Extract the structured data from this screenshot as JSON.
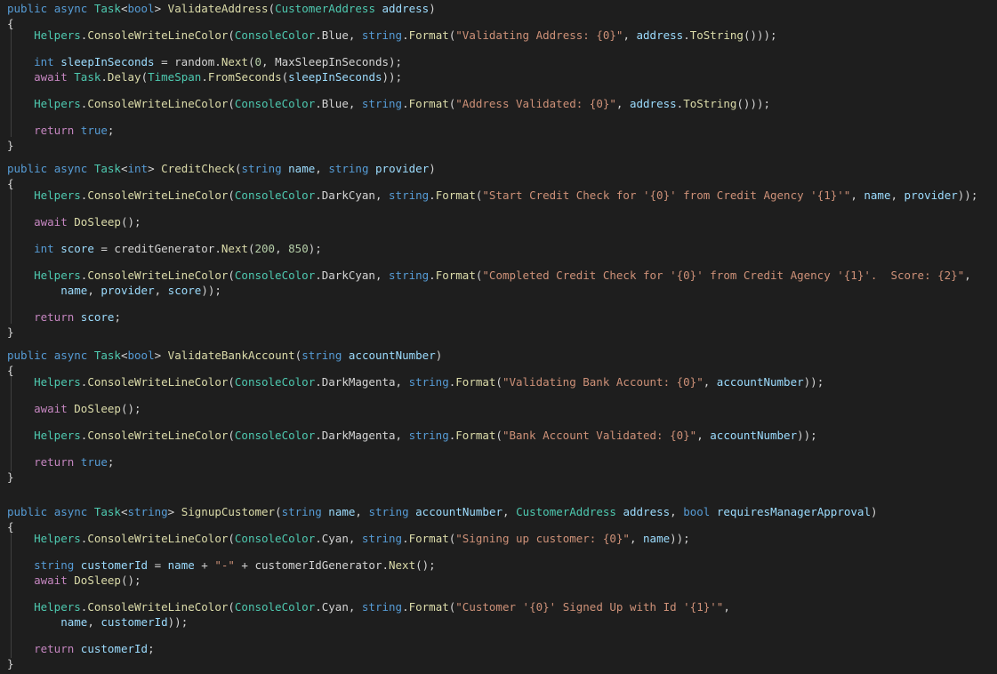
{
  "editor": {
    "language": "csharp",
    "token_colors": {
      "kw": "#569cd6",
      "ctl": "#c586c0",
      "type": "#4ec9b0",
      "fn": "#dcdcaa",
      "var": "#9cdcfe",
      "str": "#ce9178",
      "num": "#b5cea8",
      "punc": "#d4d4d4",
      "background": "#1e1e1e"
    },
    "lines": [
      [
        [
          "kw",
          "public"
        ],
        [
          "punc",
          " "
        ],
        [
          "kw",
          "async"
        ],
        [
          "punc",
          " "
        ],
        [
          "type",
          "Task"
        ],
        [
          "punc",
          "<"
        ],
        [
          "kw",
          "bool"
        ],
        [
          "punc",
          "> "
        ],
        [
          "fn",
          "ValidateAddress"
        ],
        [
          "punc",
          "("
        ],
        [
          "type",
          "CustomerAddress"
        ],
        [
          "punc",
          " "
        ],
        [
          "var",
          "address"
        ],
        [
          "punc",
          ")"
        ]
      ],
      [
        [
          "brace",
          "{"
        ]
      ],
      [
        [
          "punc",
          "    "
        ],
        [
          "type",
          "Helpers"
        ],
        [
          "punc",
          "."
        ],
        [
          "fn",
          "ConsoleWriteLineColor"
        ],
        [
          "punc",
          "("
        ],
        [
          "type",
          "ConsoleColor"
        ],
        [
          "punc",
          ".Blue, "
        ],
        [
          "kw",
          "string"
        ],
        [
          "punc",
          "."
        ],
        [
          "fn",
          "Format"
        ],
        [
          "punc",
          "("
        ],
        [
          "str",
          "\"Validating Address: {0}\""
        ],
        [
          "punc",
          ", "
        ],
        [
          "var",
          "address"
        ],
        [
          "punc",
          "."
        ],
        [
          "fn",
          "ToString"
        ],
        [
          "punc",
          "()));"
        ]
      ],
      [
        [
          "punc",
          "    "
        ],
        [
          "kw",
          "int"
        ],
        [
          "punc",
          " "
        ],
        [
          "var",
          "sleepInSeconds"
        ],
        [
          "punc",
          " = random."
        ],
        [
          "fn",
          "Next"
        ],
        [
          "punc",
          "("
        ],
        [
          "num",
          "0"
        ],
        [
          "punc",
          ", MaxSleepInSeconds);"
        ]
      ],
      [
        [
          "punc",
          "    "
        ],
        [
          "ctl",
          "await"
        ],
        [
          "punc",
          " "
        ],
        [
          "type",
          "Task"
        ],
        [
          "punc",
          "."
        ],
        [
          "fn",
          "Delay"
        ],
        [
          "punc",
          "("
        ],
        [
          "type",
          "TimeSpan"
        ],
        [
          "punc",
          "."
        ],
        [
          "fn",
          "FromSeconds"
        ],
        [
          "punc",
          "("
        ],
        [
          "var",
          "sleepInSeconds"
        ],
        [
          "punc",
          "));"
        ]
      ],
      [
        [
          "punc",
          "    "
        ],
        [
          "type",
          "Helpers"
        ],
        [
          "punc",
          "."
        ],
        [
          "fn",
          "ConsoleWriteLineColor"
        ],
        [
          "punc",
          "("
        ],
        [
          "type",
          "ConsoleColor"
        ],
        [
          "punc",
          ".Blue, "
        ],
        [
          "kw",
          "string"
        ],
        [
          "punc",
          "."
        ],
        [
          "fn",
          "Format"
        ],
        [
          "punc",
          "("
        ],
        [
          "str",
          "\"Address Validated: {0}\""
        ],
        [
          "punc",
          ", "
        ],
        [
          "var",
          "address"
        ],
        [
          "punc",
          "."
        ],
        [
          "fn",
          "ToString"
        ],
        [
          "punc",
          "()));"
        ]
      ],
      [
        [
          "punc",
          "    "
        ],
        [
          "ctl",
          "return"
        ],
        [
          "punc",
          " "
        ],
        [
          "kw",
          "true"
        ],
        [
          "punc",
          ";"
        ]
      ],
      [
        [
          "brace",
          "}"
        ]
      ],
      [
        [
          "kw",
          "public"
        ],
        [
          "punc",
          " "
        ],
        [
          "kw",
          "async"
        ],
        [
          "punc",
          " "
        ],
        [
          "type",
          "Task"
        ],
        [
          "punc",
          "<"
        ],
        [
          "kw",
          "int"
        ],
        [
          "punc",
          "> "
        ],
        [
          "fn",
          "CreditCheck"
        ],
        [
          "punc",
          "("
        ],
        [
          "kw",
          "string"
        ],
        [
          "punc",
          " "
        ],
        [
          "var",
          "name"
        ],
        [
          "punc",
          ", "
        ],
        [
          "kw",
          "string"
        ],
        [
          "punc",
          " "
        ],
        [
          "var",
          "provider"
        ],
        [
          "punc",
          ")"
        ]
      ],
      [
        [
          "brace",
          "{"
        ]
      ],
      [
        [
          "punc",
          "    "
        ],
        [
          "type",
          "Helpers"
        ],
        [
          "punc",
          "."
        ],
        [
          "fn",
          "ConsoleWriteLineColor"
        ],
        [
          "punc",
          "("
        ],
        [
          "type",
          "ConsoleColor"
        ],
        [
          "punc",
          ".DarkCyan, "
        ],
        [
          "kw",
          "string"
        ],
        [
          "punc",
          "."
        ],
        [
          "fn",
          "Format"
        ],
        [
          "punc",
          "("
        ],
        [
          "str",
          "\"Start Credit Check for '{0}' from Credit Agency '{1}'\""
        ],
        [
          "punc",
          ", "
        ],
        [
          "var",
          "name"
        ],
        [
          "punc",
          ", "
        ],
        [
          "var",
          "provider"
        ],
        [
          "punc",
          "));"
        ]
      ],
      [
        [
          "punc",
          "    "
        ],
        [
          "ctl",
          "await"
        ],
        [
          "punc",
          " "
        ],
        [
          "fn",
          "DoSleep"
        ],
        [
          "punc",
          "();"
        ]
      ],
      [
        [
          "punc",
          "    "
        ],
        [
          "kw",
          "int"
        ],
        [
          "punc",
          " "
        ],
        [
          "var",
          "score"
        ],
        [
          "punc",
          " = creditGenerator."
        ],
        [
          "fn",
          "Next"
        ],
        [
          "punc",
          "("
        ],
        [
          "num",
          "200"
        ],
        [
          "punc",
          ", "
        ],
        [
          "num",
          "850"
        ],
        [
          "punc",
          ");"
        ]
      ],
      [
        [
          "punc",
          "    "
        ],
        [
          "type",
          "Helpers"
        ],
        [
          "punc",
          "."
        ],
        [
          "fn",
          "ConsoleWriteLineColor"
        ],
        [
          "punc",
          "("
        ],
        [
          "type",
          "ConsoleColor"
        ],
        [
          "punc",
          ".DarkCyan, "
        ],
        [
          "kw",
          "string"
        ],
        [
          "punc",
          "."
        ],
        [
          "fn",
          "Format"
        ],
        [
          "punc",
          "("
        ],
        [
          "str",
          "\"Completed Credit Check for '{0}' from Credit Agency '{1}'.  Score: {2}\""
        ],
        [
          "punc",
          ","
        ]
      ],
      [
        [
          "punc",
          "        "
        ],
        [
          "var",
          "name"
        ],
        [
          "punc",
          ", "
        ],
        [
          "var",
          "provider"
        ],
        [
          "punc",
          ", "
        ],
        [
          "var",
          "score"
        ],
        [
          "punc",
          "));"
        ]
      ],
      [
        [
          "punc",
          "    "
        ],
        [
          "ctl",
          "return"
        ],
        [
          "punc",
          " "
        ],
        [
          "var",
          "score"
        ],
        [
          "punc",
          ";"
        ]
      ],
      [
        [
          "brace",
          "}"
        ]
      ],
      [
        [
          "kw",
          "public"
        ],
        [
          "punc",
          " "
        ],
        [
          "kw",
          "async"
        ],
        [
          "punc",
          " "
        ],
        [
          "type",
          "Task"
        ],
        [
          "punc",
          "<"
        ],
        [
          "kw",
          "bool"
        ],
        [
          "punc",
          "> "
        ],
        [
          "fn",
          "ValidateBankAccount"
        ],
        [
          "punc",
          "("
        ],
        [
          "kw",
          "string"
        ],
        [
          "punc",
          " "
        ],
        [
          "var",
          "accountNumber"
        ],
        [
          "punc",
          ")"
        ]
      ],
      [
        [
          "brace",
          "{"
        ]
      ],
      [
        [
          "punc",
          "    "
        ],
        [
          "type",
          "Helpers"
        ],
        [
          "punc",
          "."
        ],
        [
          "fn",
          "ConsoleWriteLineColor"
        ],
        [
          "punc",
          "("
        ],
        [
          "type",
          "ConsoleColor"
        ],
        [
          "punc",
          ".DarkMagenta, "
        ],
        [
          "kw",
          "string"
        ],
        [
          "punc",
          "."
        ],
        [
          "fn",
          "Format"
        ],
        [
          "punc",
          "("
        ],
        [
          "str",
          "\"Validating Bank Account: {0}\""
        ],
        [
          "punc",
          ", "
        ],
        [
          "var",
          "accountNumber"
        ],
        [
          "punc",
          "));"
        ]
      ],
      [
        [
          "punc",
          "    "
        ],
        [
          "ctl",
          "await"
        ],
        [
          "punc",
          " "
        ],
        [
          "fn",
          "DoSleep"
        ],
        [
          "punc",
          "();"
        ]
      ],
      [
        [
          "punc",
          "    "
        ],
        [
          "type",
          "Helpers"
        ],
        [
          "punc",
          "."
        ],
        [
          "fn",
          "ConsoleWriteLineColor"
        ],
        [
          "punc",
          "("
        ],
        [
          "type",
          "ConsoleColor"
        ],
        [
          "punc",
          ".DarkMagenta, "
        ],
        [
          "kw",
          "string"
        ],
        [
          "punc",
          "."
        ],
        [
          "fn",
          "Format"
        ],
        [
          "punc",
          "("
        ],
        [
          "str",
          "\"Bank Account Validated: {0}\""
        ],
        [
          "punc",
          ", "
        ],
        [
          "var",
          "accountNumber"
        ],
        [
          "punc",
          "));"
        ]
      ],
      [
        [
          "punc",
          "    "
        ],
        [
          "ctl",
          "return"
        ],
        [
          "punc",
          " "
        ],
        [
          "kw",
          "true"
        ],
        [
          "punc",
          ";"
        ]
      ],
      [
        [
          "brace",
          "}"
        ]
      ],
      [
        [
          "kw",
          "public"
        ],
        [
          "punc",
          " "
        ],
        [
          "kw",
          "async"
        ],
        [
          "punc",
          " "
        ],
        [
          "type",
          "Task"
        ],
        [
          "punc",
          "<"
        ],
        [
          "kw",
          "string"
        ],
        [
          "punc",
          "> "
        ],
        [
          "fn",
          "SignupCustomer"
        ],
        [
          "punc",
          "("
        ],
        [
          "kw",
          "string"
        ],
        [
          "punc",
          " "
        ],
        [
          "var",
          "name"
        ],
        [
          "punc",
          ", "
        ],
        [
          "kw",
          "string"
        ],
        [
          "punc",
          " "
        ],
        [
          "var",
          "accountNumber"
        ],
        [
          "punc",
          ", "
        ],
        [
          "type",
          "CustomerAddress"
        ],
        [
          "punc",
          " "
        ],
        [
          "var",
          "address"
        ],
        [
          "punc",
          ", "
        ],
        [
          "kw",
          "bool"
        ],
        [
          "punc",
          " "
        ],
        [
          "var",
          "requiresManagerApproval"
        ],
        [
          "punc",
          ")"
        ]
      ],
      [
        [
          "brace",
          "{"
        ]
      ],
      [
        [
          "punc",
          "    "
        ],
        [
          "type",
          "Helpers"
        ],
        [
          "punc",
          "."
        ],
        [
          "fn",
          "ConsoleWriteLineColor"
        ],
        [
          "punc",
          "("
        ],
        [
          "type",
          "ConsoleColor"
        ],
        [
          "punc",
          ".Cyan, "
        ],
        [
          "kw",
          "string"
        ],
        [
          "punc",
          "."
        ],
        [
          "fn",
          "Format"
        ],
        [
          "punc",
          "("
        ],
        [
          "str",
          "\"Signing up customer: {0}\""
        ],
        [
          "punc",
          ", "
        ],
        [
          "var",
          "name"
        ],
        [
          "punc",
          "));"
        ]
      ],
      [
        [
          "punc",
          "    "
        ],
        [
          "kw",
          "string"
        ],
        [
          "punc",
          " "
        ],
        [
          "var",
          "customerId"
        ],
        [
          "punc",
          " = "
        ],
        [
          "var",
          "name"
        ],
        [
          "punc",
          " + "
        ],
        [
          "str",
          "\"-\""
        ],
        [
          "punc",
          " + customerIdGenerator."
        ],
        [
          "fn",
          "Next"
        ],
        [
          "punc",
          "();"
        ]
      ],
      [
        [
          "punc",
          "    "
        ],
        [
          "ctl",
          "await"
        ],
        [
          "punc",
          " "
        ],
        [
          "fn",
          "DoSleep"
        ],
        [
          "punc",
          "();"
        ]
      ],
      [
        [
          "punc",
          "    "
        ],
        [
          "type",
          "Helpers"
        ],
        [
          "punc",
          "."
        ],
        [
          "fn",
          "ConsoleWriteLineColor"
        ],
        [
          "punc",
          "("
        ],
        [
          "type",
          "ConsoleColor"
        ],
        [
          "punc",
          ".Cyan, "
        ],
        [
          "kw",
          "string"
        ],
        [
          "punc",
          "."
        ],
        [
          "fn",
          "Format"
        ],
        [
          "punc",
          "("
        ],
        [
          "str",
          "\"Customer '{0}' Signed Up with Id '{1}'\""
        ],
        [
          "punc",
          ","
        ]
      ],
      [
        [
          "punc",
          "        "
        ],
        [
          "var",
          "name"
        ],
        [
          "punc",
          ", "
        ],
        [
          "var",
          "customerId"
        ],
        [
          "punc",
          "));"
        ]
      ],
      [
        [
          "punc",
          "    "
        ],
        [
          "ctl",
          "return"
        ],
        [
          "punc",
          " "
        ],
        [
          "var",
          "customerId"
        ],
        [
          "punc",
          ";"
        ]
      ],
      [
        [
          "brace",
          "}"
        ]
      ]
    ]
  }
}
